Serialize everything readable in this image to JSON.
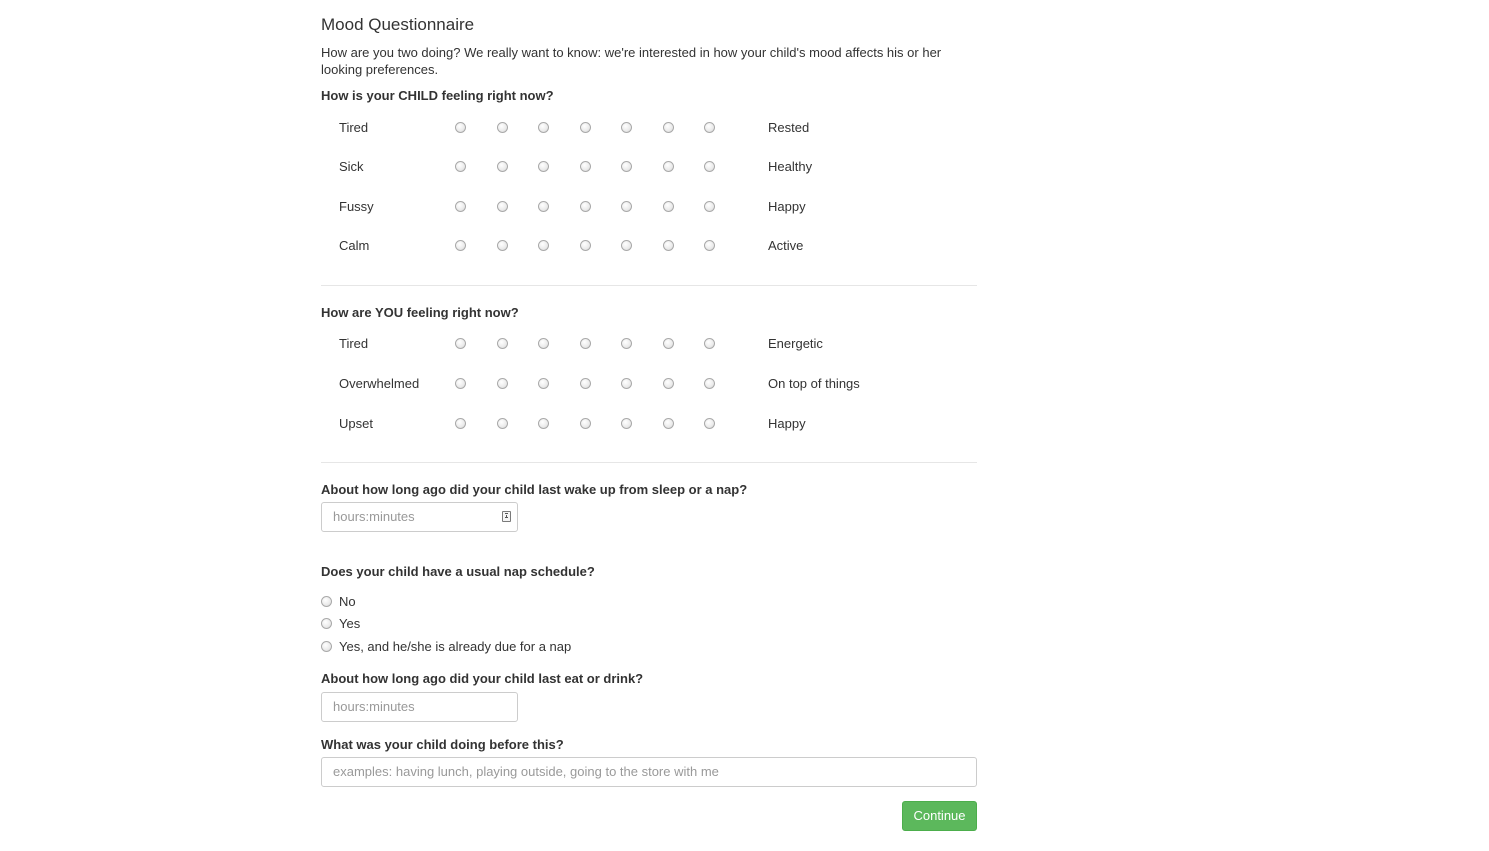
{
  "form": {
    "title": "Mood Questionnaire",
    "intro": "How are you two doing? We really want to know: we're interested in how your child's mood affects his or her looking preferences.",
    "child_section": {
      "question": "How is your CHILD feeling right now?",
      "scale_points": 7,
      "rows": [
        {
          "left": "Tired",
          "right": "Rested",
          "selected": null
        },
        {
          "left": "Sick",
          "right": "Healthy",
          "selected": null
        },
        {
          "left": "Fussy",
          "right": "Happy",
          "selected": null
        },
        {
          "left": "Calm",
          "right": "Active",
          "selected": null
        }
      ]
    },
    "parent_section": {
      "question": "How are YOU feeling right now?",
      "scale_points": 7,
      "rows": [
        {
          "left": "Tired",
          "right": "Energetic",
          "selected": null
        },
        {
          "left": "Overwhelmed",
          "right": "On top of things",
          "selected": null
        },
        {
          "left": "Upset",
          "right": "Happy",
          "selected": null
        }
      ]
    },
    "last_wake": {
      "question": "About how long ago did your child last wake up from sleep or a nap?",
      "value": "",
      "placeholder": "hours:minutes",
      "icon": "contact-card-icon"
    },
    "nap_schedule": {
      "question": "Does your child have a usual nap schedule?",
      "options": [
        "No",
        "Yes",
        "Yes, and he/she is already due for a nap"
      ],
      "selected": null
    },
    "last_eat": {
      "question": "About how long ago did your child last eat or drink?",
      "value": "",
      "placeholder": "hours:minutes"
    },
    "activity": {
      "question": "What was your child doing before this?",
      "value": "",
      "placeholder": "examples: having lunch, playing outside, going to the store with me"
    },
    "continue_label": "Continue",
    "colors": {
      "accent_green": "#5cb85c",
      "text": "#333333",
      "placeholder": "#999999",
      "divider": "#e6e6e6"
    }
  }
}
